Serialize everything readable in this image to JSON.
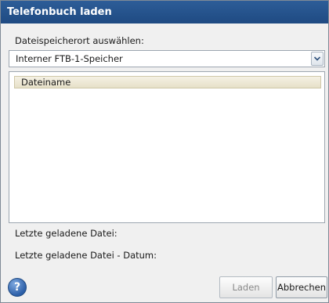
{
  "dialog": {
    "title": "Telefonbuch laden"
  },
  "location": {
    "label": "Dateispeicherort auswählen:",
    "selected": "Interner FTB-1-Speicher"
  },
  "file_list": {
    "columns": [
      "Dateiname"
    ],
    "rows": []
  },
  "info": {
    "last_loaded_file_label": "Letzte geladene Datei:",
    "last_loaded_date_label": "Letzte geladene Datei - Datum:"
  },
  "buttons": {
    "help_symbol": "?",
    "load_label": "Laden",
    "cancel_label": "Abbrechen"
  },
  "icons": {
    "dropdown": "chevron-down-icon",
    "help": "help-icon"
  },
  "colors": {
    "title_bar": "#1f4a82",
    "title_text": "#ffffff",
    "help_button": "#2c5fa8",
    "column_header": "#e6e0c8"
  }
}
